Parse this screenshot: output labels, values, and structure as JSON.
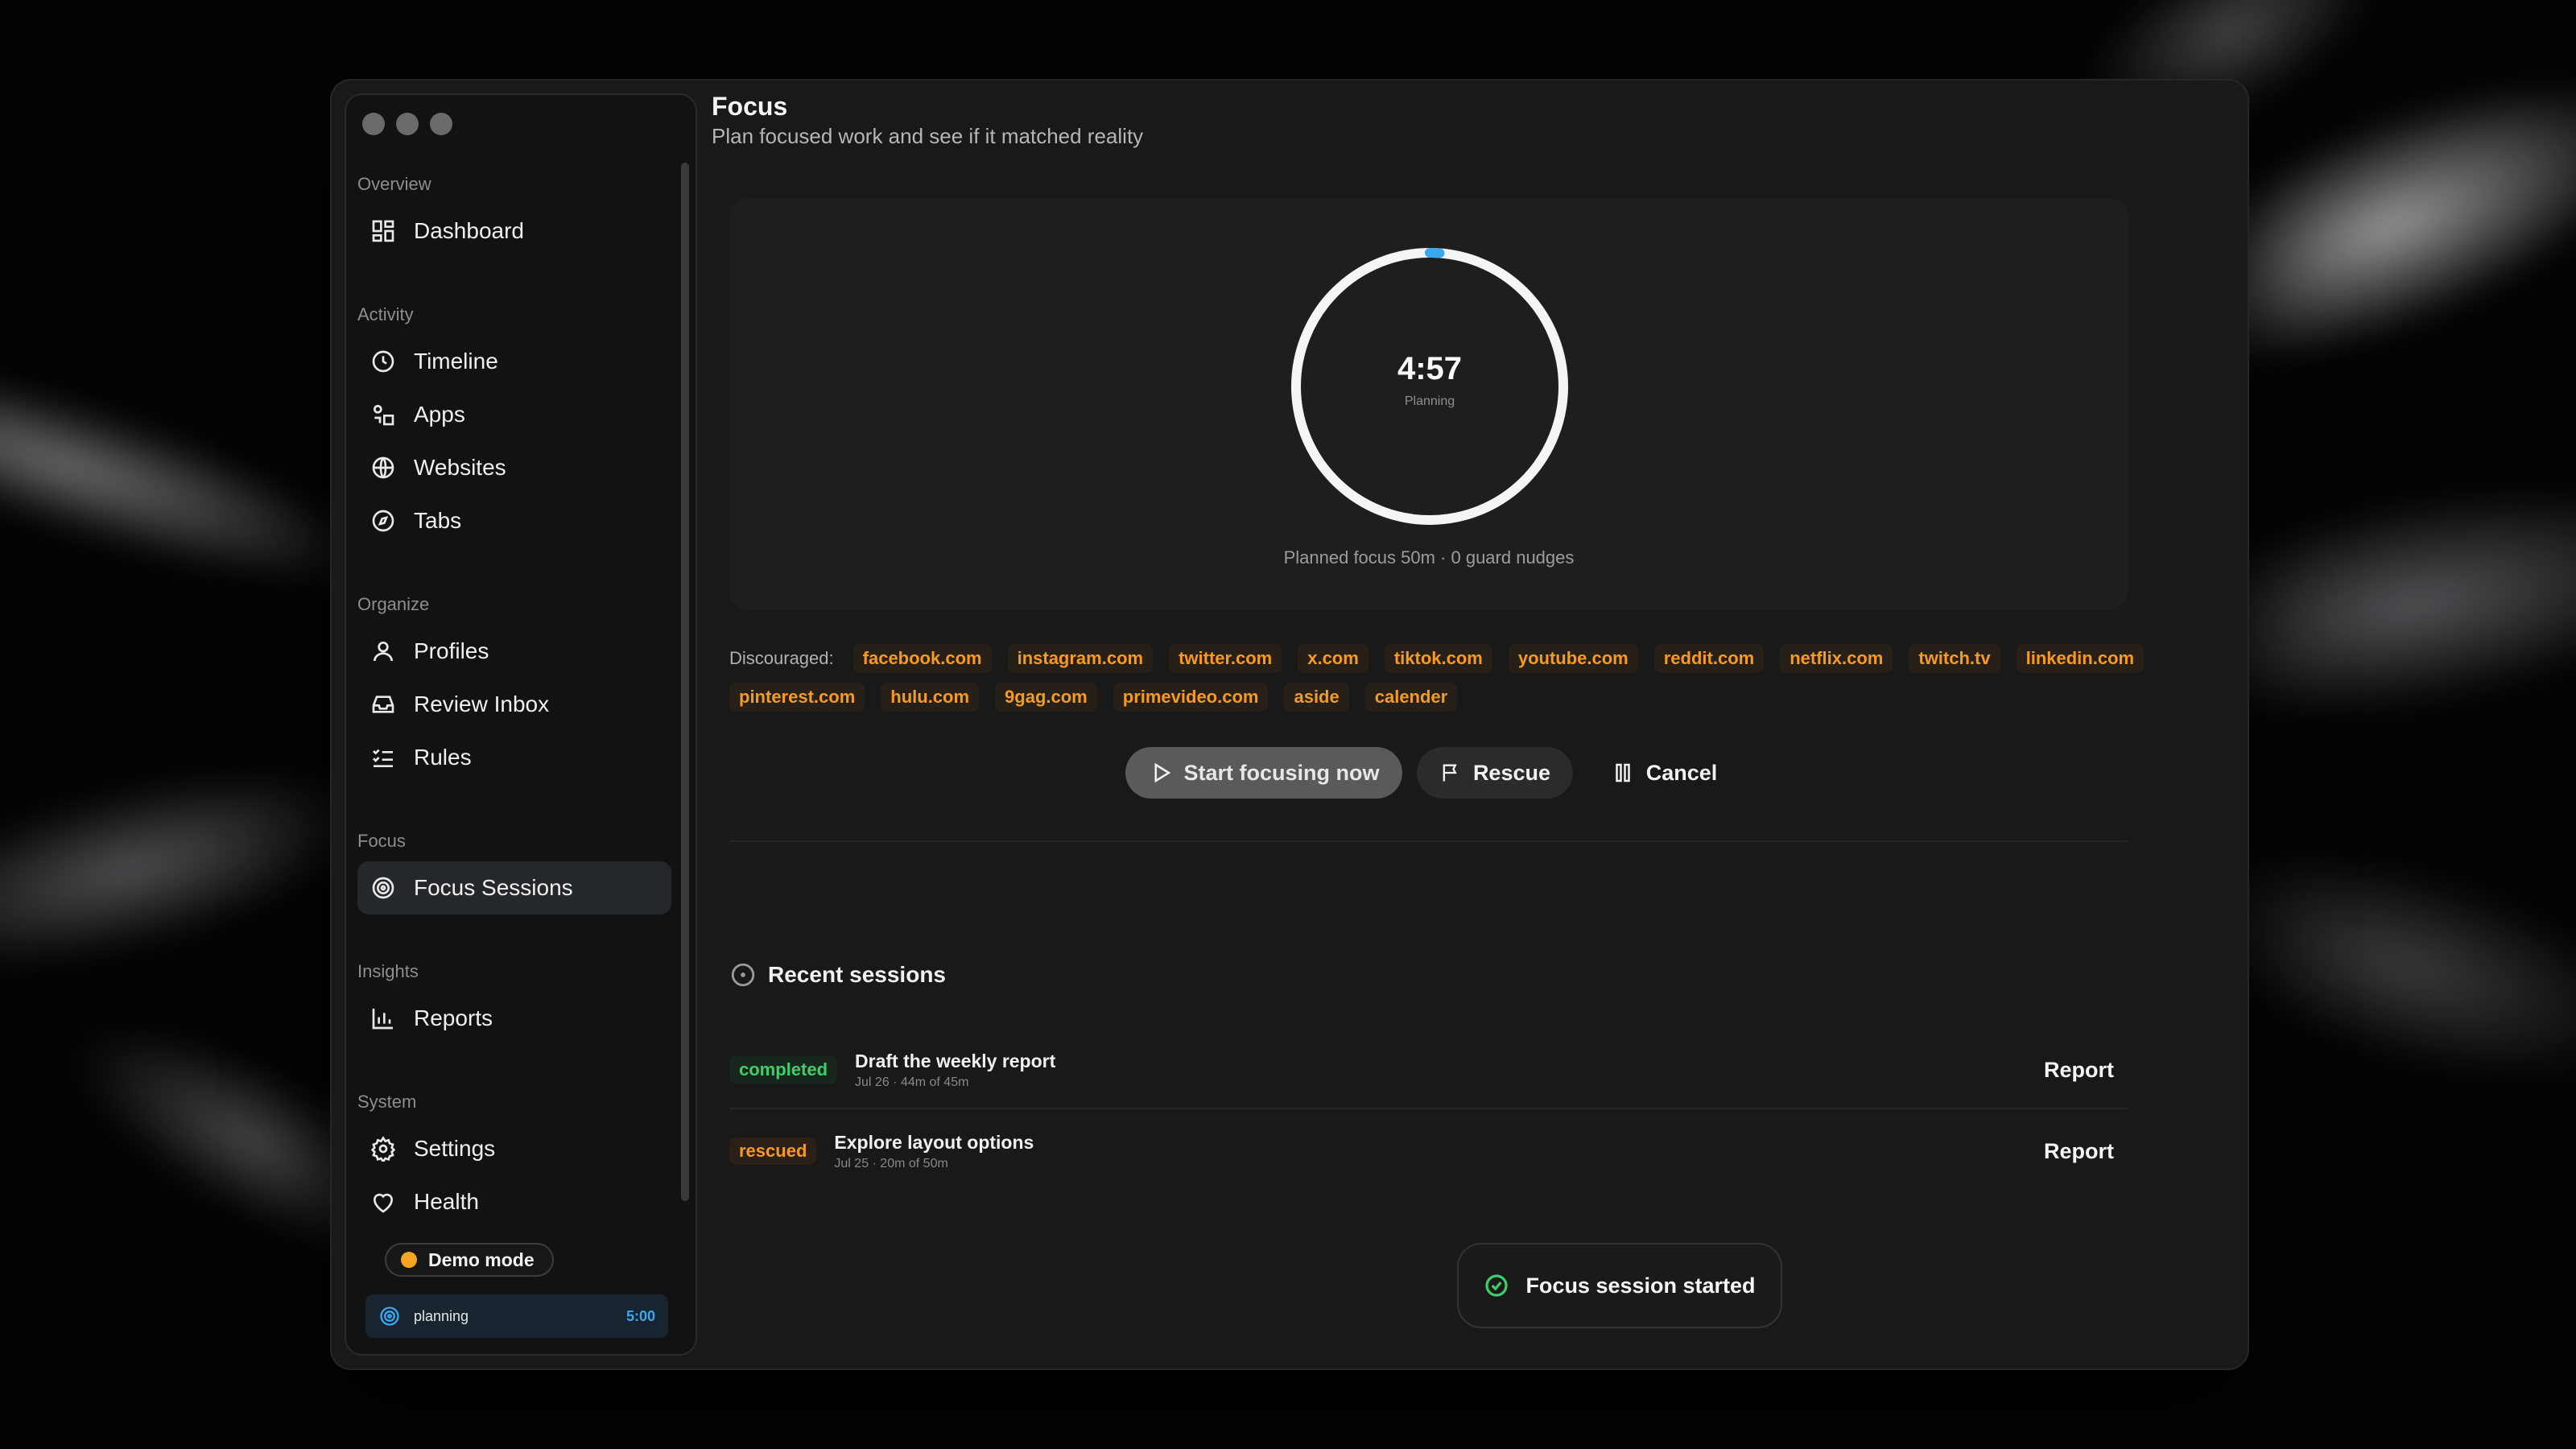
{
  "app": {
    "window_title": "Focus"
  },
  "sidebar": {
    "groups": [
      {
        "label": "Overview",
        "items": [
          {
            "label": "Dashboard",
            "icon": "dashboard-icon"
          }
        ]
      },
      {
        "label": "Activity",
        "items": [
          {
            "label": "Timeline",
            "icon": "clock-icon"
          },
          {
            "label": "Apps",
            "icon": "apps-icon"
          },
          {
            "label": "Websites",
            "icon": "globe-icon"
          },
          {
            "label": "Tabs",
            "icon": "compass-icon"
          }
        ]
      },
      {
        "label": "Organize",
        "items": [
          {
            "label": "Profiles",
            "icon": "user-icon"
          },
          {
            "label": "Review Inbox",
            "icon": "inbox-icon"
          },
          {
            "label": "Rules",
            "icon": "checklist-icon"
          }
        ]
      },
      {
        "label": "Focus",
        "items": [
          {
            "label": "Focus Sessions",
            "icon": "target-icon",
            "active": true
          }
        ]
      },
      {
        "label": "Insights",
        "items": [
          {
            "label": "Reports",
            "icon": "bar-chart-icon"
          }
        ]
      },
      {
        "label": "System",
        "items": [
          {
            "label": "Settings",
            "icon": "gear-icon"
          },
          {
            "label": "Health",
            "icon": "heart-icon"
          }
        ]
      }
    ],
    "demo_mode": "Demo mode",
    "status": {
      "label": "planning",
      "time": "5:00"
    }
  },
  "page": {
    "title": "Focus",
    "subtitle": "Plan focused work and see if it matched reality"
  },
  "timer": {
    "value": "4:57",
    "status": "Planning",
    "progress": 0.01,
    "note": "Planned focus 50m · 0 guard nudges",
    "accent": "#3aa8f0"
  },
  "discouraged": {
    "label": "Discouraged:",
    "sites": [
      "facebook.com",
      "instagram.com",
      "twitter.com",
      "x.com",
      "tiktok.com",
      "youtube.com",
      "reddit.com",
      "netflix.com",
      "twitch.tv",
      "linkedin.com",
      "pinterest.com",
      "hulu.com",
      "9gag.com",
      "primevideo.com",
      "aside",
      "calender"
    ]
  },
  "actions": {
    "start": "Start focusing now",
    "rescue": "Rescue",
    "cancel": "Cancel"
  },
  "recent": {
    "heading": "Recent sessions",
    "sessions": [
      {
        "status": "completed",
        "status_color": "green",
        "title": "Draft the weekly report",
        "meta": "Jul 26 · 44m of 45m",
        "action": "Report"
      },
      {
        "status": "rescued",
        "status_color": "orange",
        "title": "Explore layout options",
        "meta": "Jul 25 · 20m of 50m",
        "action": "Report"
      }
    ]
  },
  "toast": {
    "message": "Focus session started"
  },
  "colors": {
    "accent_blue": "#3aa8f0",
    "warning_orange": "#f59a23",
    "success_green": "#3ecf6a"
  }
}
